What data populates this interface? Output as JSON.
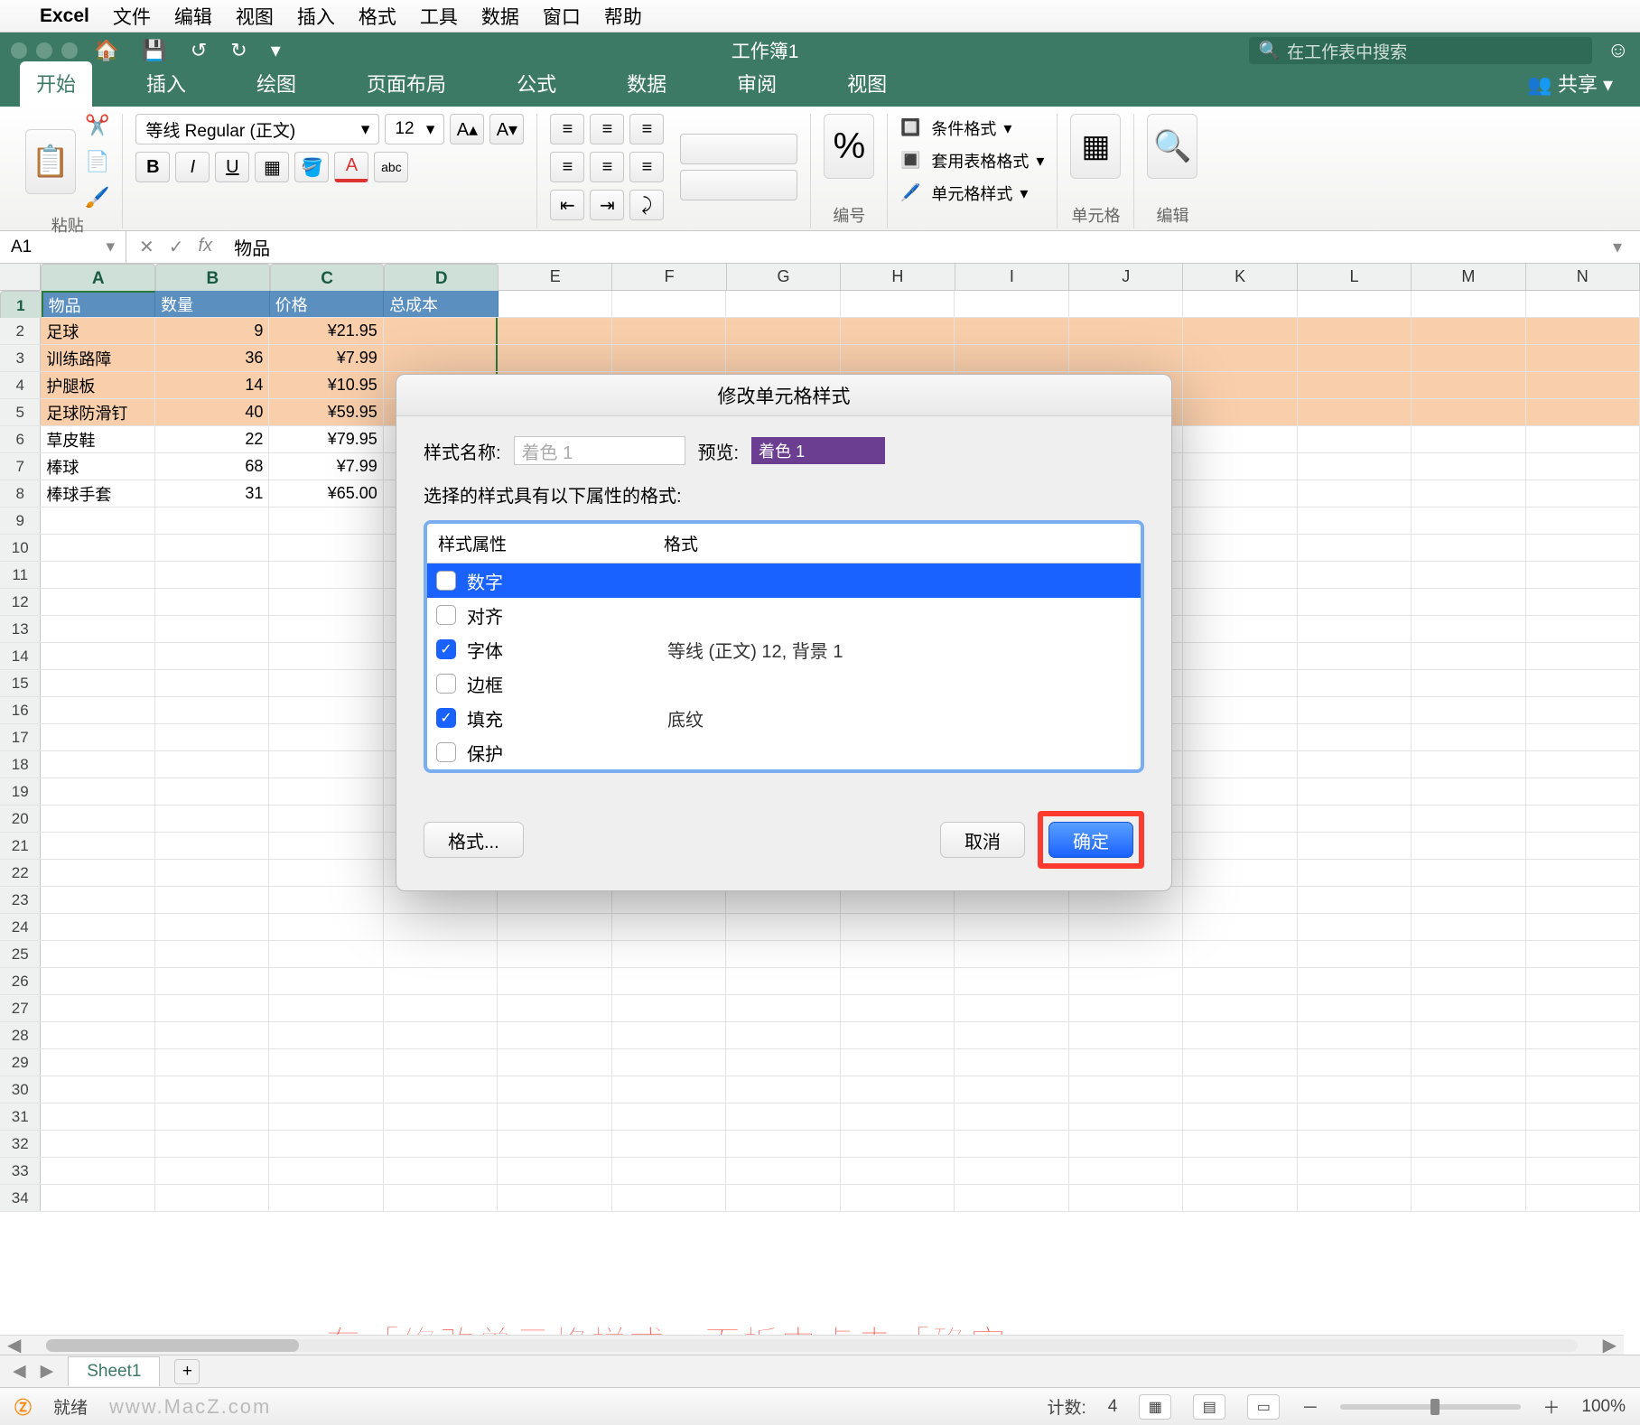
{
  "mac_menu": {
    "app": "Excel",
    "items": [
      "文件",
      "编辑",
      "视图",
      "插入",
      "格式",
      "工具",
      "数据",
      "窗口",
      "帮助"
    ]
  },
  "titlebar": {
    "title": "工作簿1",
    "search_placeholder": "在工作表中搜索"
  },
  "ribbon_tabs": [
    "开始",
    "插入",
    "绘图",
    "页面布局",
    "公式",
    "数据",
    "审阅",
    "视图"
  ],
  "ribbon_share": "共享",
  "ribbon": {
    "paste": "粘贴",
    "font_name": "等线 Regular (正文)",
    "font_size": "12",
    "number_group": "编号",
    "styles": {
      "cond": "条件格式",
      "tbl": "套用表格格式",
      "cell": "单元格样式"
    },
    "cells_group": "单元格",
    "edit_group": "编辑"
  },
  "formula_bar": {
    "cell_ref": "A1",
    "value": "物品"
  },
  "columns": [
    "A",
    "B",
    "C",
    "D",
    "E",
    "F",
    "G",
    "H",
    "I",
    "J",
    "K",
    "L",
    "M",
    "N"
  ],
  "header_row": [
    "物品",
    "数量",
    "价格",
    "总成本"
  ],
  "data_rows": [
    {
      "a": "足球",
      "b": "9",
      "c": "¥21.95"
    },
    {
      "a": "训练路障",
      "b": "36",
      "c": "¥7.99"
    },
    {
      "a": "护腿板",
      "b": "14",
      "c": "¥10.95"
    },
    {
      "a": "足球防滑钉",
      "b": "40",
      "c": "¥59.95"
    },
    {
      "a": "草皮鞋",
      "b": "22",
      "c": "¥79.95"
    },
    {
      "a": "棒球",
      "b": "68",
      "c": "¥7.99"
    },
    {
      "a": "棒球手套",
      "b": "31",
      "c": "¥65.00"
    }
  ],
  "row_numbers": [
    "1",
    "2",
    "3",
    "4",
    "5",
    "6",
    "7",
    "8",
    "9",
    "10",
    "11",
    "12",
    "13",
    "14",
    "15",
    "16",
    "17",
    "18",
    "19",
    "20",
    "21",
    "22",
    "23",
    "24",
    "25",
    "26",
    "27",
    "28",
    "29",
    "30",
    "31",
    "32",
    "33",
    "34"
  ],
  "dialog": {
    "title": "修改单元格样式",
    "name_label": "样式名称:",
    "name_value": "着色 1",
    "preview_label": "预览:",
    "preview_chip": "着色 1",
    "subtitle": "选择的样式具有以下属性的格式:",
    "col_attr": "样式属性",
    "col_fmt": "格式",
    "rows": [
      {
        "checked": false,
        "label": "数字",
        "fmt": ""
      },
      {
        "checked": false,
        "label": "对齐",
        "fmt": ""
      },
      {
        "checked": true,
        "label": "字体",
        "fmt": "等线 (正文) 12, 背景 1"
      },
      {
        "checked": false,
        "label": "边框",
        "fmt": ""
      },
      {
        "checked": true,
        "label": "填充",
        "fmt": "底纹"
      },
      {
        "checked": false,
        "label": "保护",
        "fmt": ""
      }
    ],
    "format_btn": "格式...",
    "cancel": "取消",
    "ok": "确定"
  },
  "annotation": "在「修改单元格样式」面板中点击「确定」",
  "sheet_tab": "Sheet1",
  "statusbar": {
    "ready": "就绪",
    "count_label": "计数:",
    "count": "4",
    "zoom": "100%",
    "watermark": "www.MacZ.com"
  }
}
